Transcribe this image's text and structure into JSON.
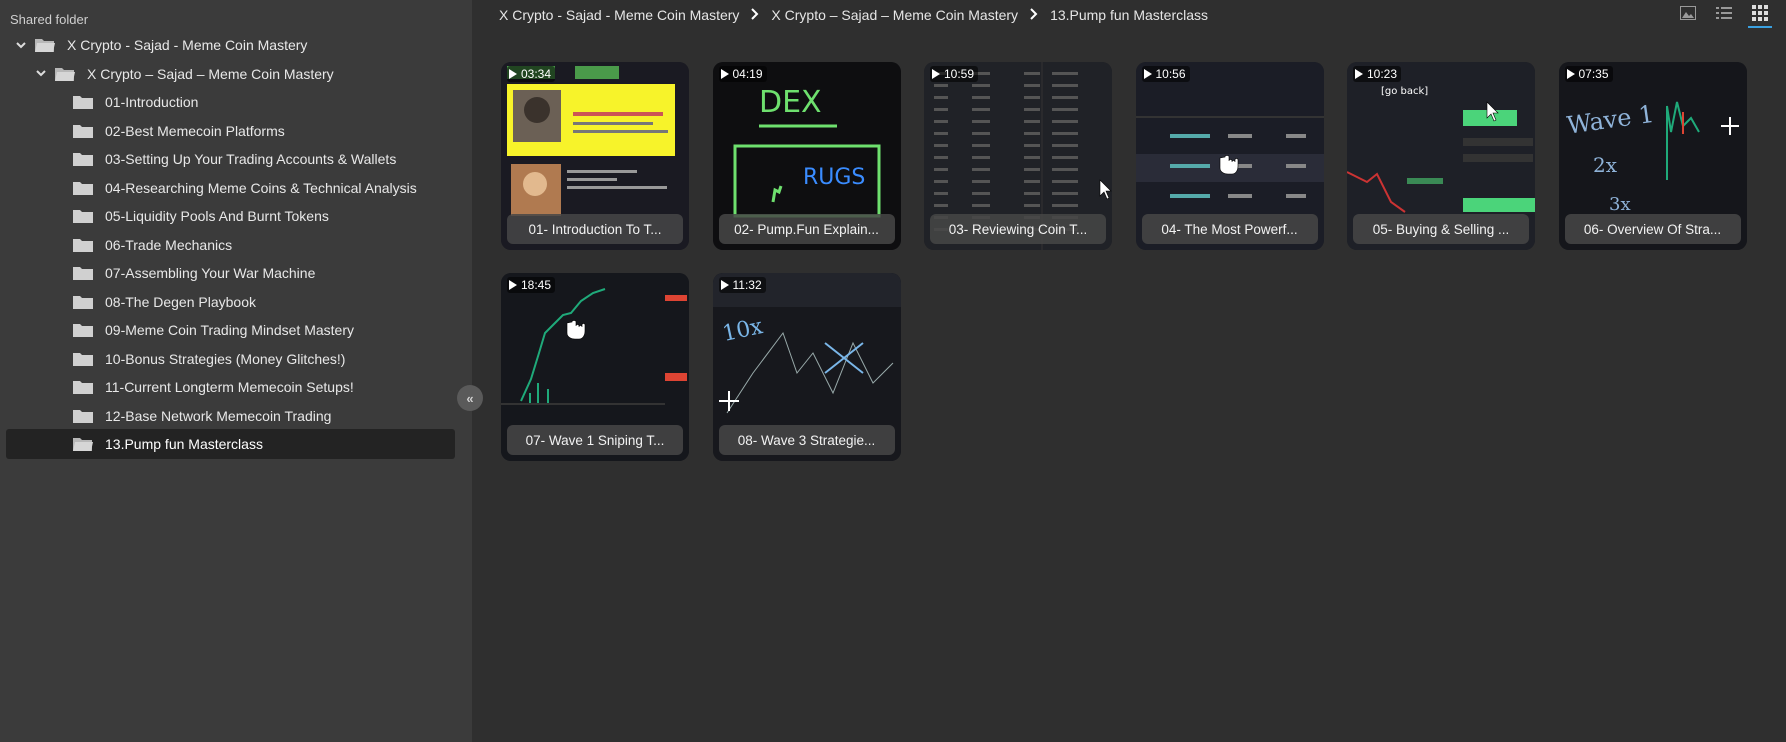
{
  "sidebar": {
    "header": "Shared folder",
    "tree": [
      {
        "label": "X Crypto - Sajad - Meme Coin Mastery",
        "level": 0,
        "expanded": true
      },
      {
        "label": "X Crypto – Sajad – Meme Coin Mastery",
        "level": 1,
        "expanded": true
      },
      {
        "label": "01-Introduction",
        "level": 2
      },
      {
        "label": "02-Best Memecoin Platforms",
        "level": 2
      },
      {
        "label": "03-Setting Up Your Trading Accounts & Wallets",
        "level": 2
      },
      {
        "label": "04-Researching Meme Coins & Technical Analysis",
        "level": 2
      },
      {
        "label": "05-Liquidity Pools And Burnt Tokens",
        "level": 2
      },
      {
        "label": "06-Trade Mechanics",
        "level": 2
      },
      {
        "label": "07-Assembling Your War Machine",
        "level": 2
      },
      {
        "label": "08-The Degen Playbook",
        "level": 2
      },
      {
        "label": "09-Meme Coin Trading Mindset Mastery",
        "level": 2
      },
      {
        "label": "10-Bonus Strategies (Money Glitches!)",
        "level": 2
      },
      {
        "label": "11-Current Longterm Memecoin Setups!",
        "level": 2
      },
      {
        "label": "12-Base Network Memecoin Trading",
        "level": 2
      },
      {
        "label": "13.Pump fun Masterclass",
        "level": 2,
        "selected": true
      }
    ],
    "collapse_icon": "double-chevron-left-icon"
  },
  "breadcrumb": {
    "items": [
      "X Crypto - Sajad - Meme Coin Mastery",
      "X Crypto – Sajad – Meme Coin Mastery",
      "13.Pump fun Masterclass"
    ]
  },
  "view_buttons": [
    {
      "name": "image-view-icon",
      "active": false
    },
    {
      "name": "list-view-icon",
      "active": false
    },
    {
      "name": "grid-view-icon",
      "active": true
    }
  ],
  "videos": [
    {
      "duration": "03:34",
      "title": "01- Introduction To T...",
      "thumb": "intro"
    },
    {
      "duration": "04:19",
      "title": "02- Pump.Fun Explain...",
      "thumb": "dex"
    },
    {
      "duration": "10:59",
      "title": "03- Reviewing Coin T...",
      "thumb": "table"
    },
    {
      "duration": "10:56",
      "title": "04- The Most Powerf...",
      "thumb": "liquidity"
    },
    {
      "duration": "10:23",
      "title": "05- Buying & Selling ...",
      "thumb": "trade"
    },
    {
      "duration": "07:35",
      "title": "06- Overview Of Stra...",
      "thumb": "wave"
    },
    {
      "duration": "18:45",
      "title": "07- Wave 1 Sniping T...",
      "thumb": "chart"
    },
    {
      "duration": "11:32",
      "title": "08- Wave 3 Strategie...",
      "thumb": "chart2"
    }
  ],
  "thumb_text": {
    "dex": "DEX",
    "rugs": "RUGS",
    "go_back": "[go back]",
    "wave": "Wave 1",
    "two_x": "2x",
    "three_x": "3x",
    "ten_x": "10x"
  },
  "colors": {
    "sidebar_bg": "#3b3b3b",
    "main_bg": "#2f2f2f",
    "selected_bg": "#232323",
    "accent": "#3aa0e0"
  }
}
